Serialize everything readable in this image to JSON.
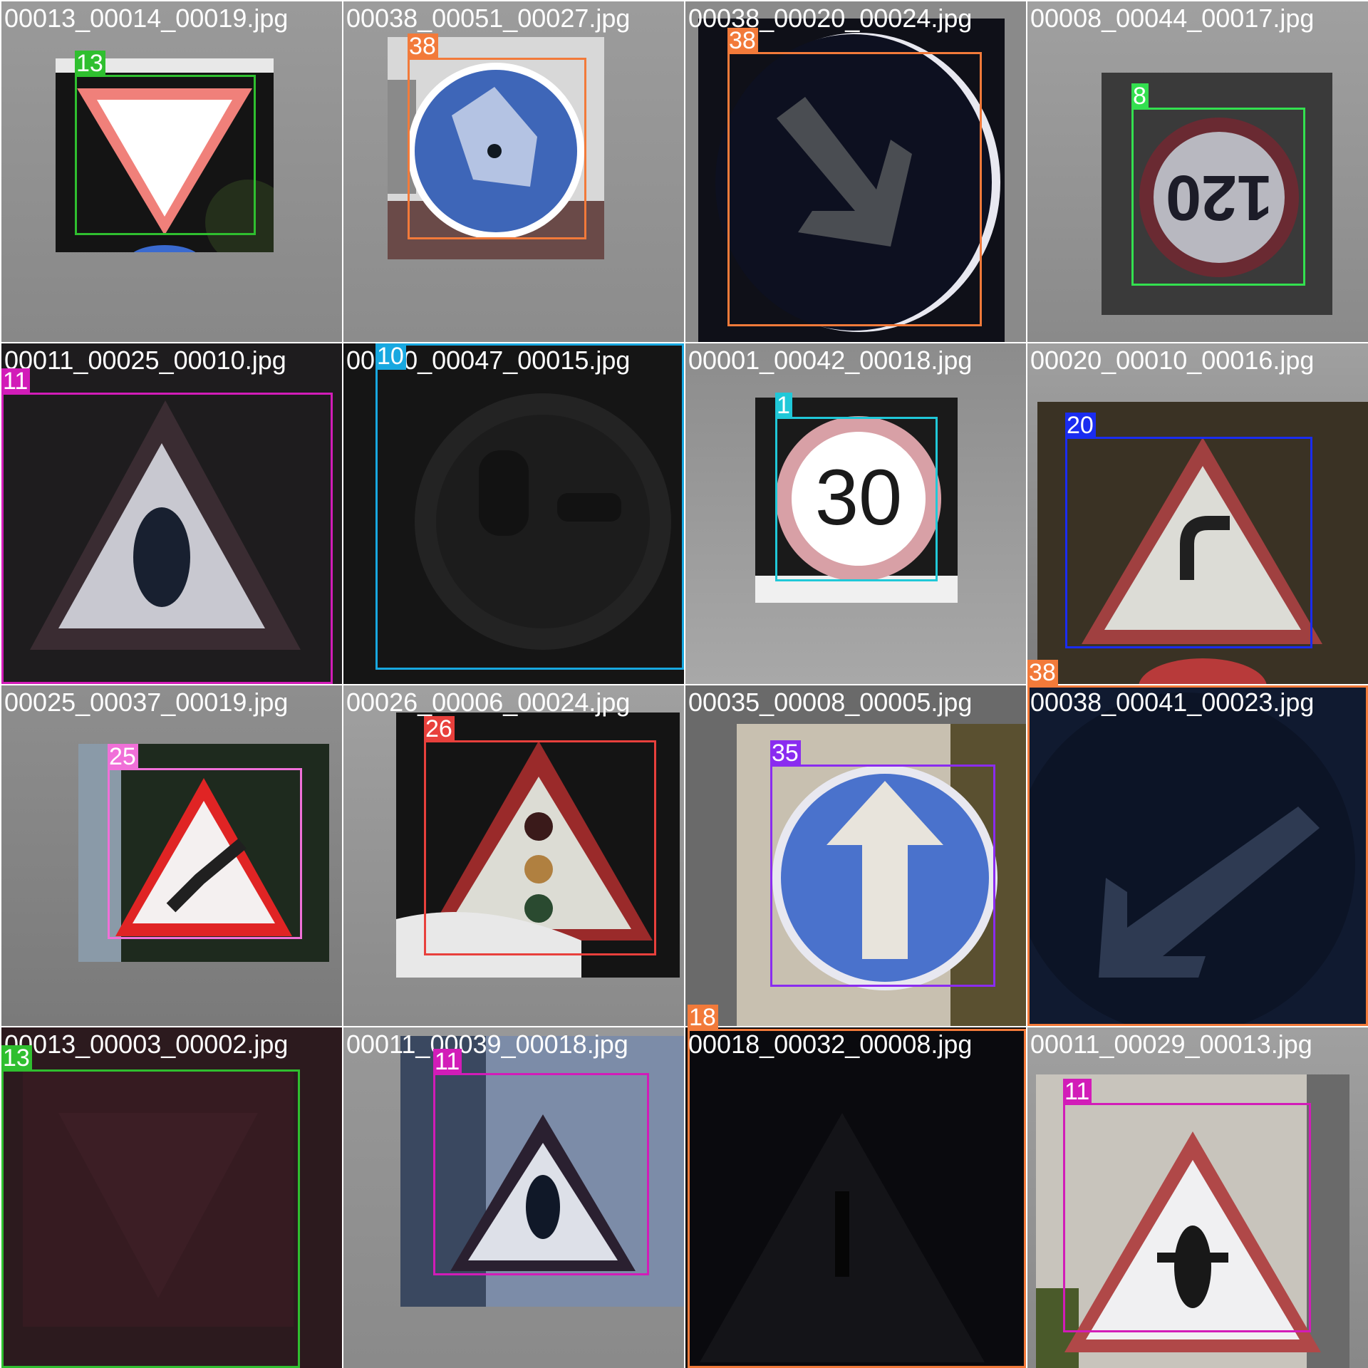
{
  "tiles": [
    {
      "filename": "00013_00014_00019.jpg",
      "class_label": "13",
      "box_color": "#2fbf2f"
    },
    {
      "filename": "00038_00051_00027.jpg",
      "class_label": "38",
      "box_color": "#f27a3a"
    },
    {
      "filename": "00038_00020_00024.jpg",
      "class_label": "38",
      "box_color": "#f27a3a"
    },
    {
      "filename": "00008_00044_00017.jpg",
      "class_label": "8",
      "box_color": "#33e04f"
    },
    {
      "filename": "00011_00025_00010.jpg",
      "class_label": "11",
      "box_color": "#d21cb8"
    },
    {
      "filename": "00010_00047_00015.jpg",
      "class_label": "10",
      "box_color": "#18a8e0"
    },
    {
      "filename": "00001_00042_00018.jpg",
      "class_label": "1",
      "box_color": "#20c8d8"
    },
    {
      "filename": "00020_00010_00016.jpg",
      "class_label": "20",
      "box_color": "#1a2cf0"
    },
    {
      "filename": "00025_00037_00019.jpg",
      "class_label": "25",
      "box_color": "#f070d8"
    },
    {
      "filename": "00026_00006_00024.jpg",
      "class_label": "26",
      "box_color": "#e8403c"
    },
    {
      "filename": "00035_00008_00005.jpg",
      "class_label": "35",
      "box_color": "#8a2cf0"
    },
    {
      "filename": "00038_00041_00023.jpg",
      "class_label": "38",
      "box_color": "#f27a3a"
    },
    {
      "filename": "00013_00003_00002.jpg",
      "class_label": "13",
      "box_color": "#2fbf2f"
    },
    {
      "filename": "00011_00039_00018.jpg",
      "class_label": "11",
      "box_color": "#d21cb8"
    },
    {
      "filename": "00018_00032_00008.jpg",
      "class_label": "18",
      "box_color": "#f27a3a"
    },
    {
      "filename": "00011_00029_00013.jpg",
      "class_label": "11",
      "box_color": "#d21cb8"
    }
  ],
  "sign_text": {
    "speed_120": "120",
    "speed_30": "30"
  }
}
